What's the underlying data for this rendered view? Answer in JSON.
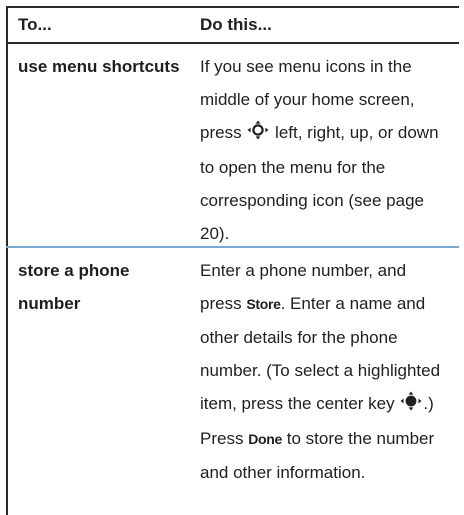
{
  "header": {
    "col1": "To...",
    "col2": "Do this..."
  },
  "rows": [
    {
      "action": "use menu shortcuts",
      "instruction": {
        "part1": "If you see menu icons in the middle of your home screen, press",
        "nav_icon": "nav-key-outline-icon",
        "part2": "left, right, up, or down to open the menu for the corresponding icon (see page 20)."
      }
    },
    {
      "action": "store a phone number",
      "instruction": {
        "part1": "Enter a phone number, and press",
        "key1": "Store",
        "part2": ". Enter a name and other details for the phone number. (To select a highlighted item, press the center key",
        "nav_icon": "nav-key-center-icon",
        "part3": ".) Press",
        "key2": "Done",
        "part4": "to store the number and other information."
      }
    }
  ],
  "colors": {
    "rule": "#2b2b2b",
    "row_divider": "#7aa8cf",
    "text": "#1f1f1f"
  }
}
